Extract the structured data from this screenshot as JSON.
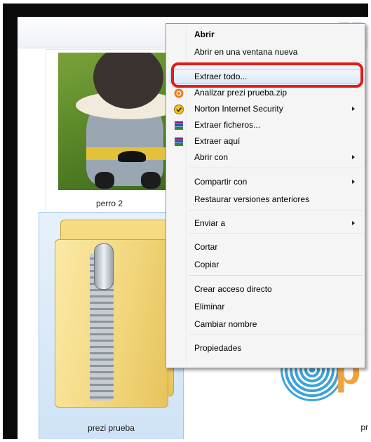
{
  "files": {
    "photo_label": "perro 2",
    "zip_label": "prezi prueba",
    "right_label": "pr"
  },
  "context_menu": {
    "items": {
      "open": "Abrir",
      "open_new_window": "Abrir en una ventana nueva",
      "extract_all": "Extraer todo...",
      "analyze": "Analizar prezi prueba.zip",
      "norton": "Norton Internet Security",
      "extract_files": "Extraer ficheros...",
      "extract_here": "Extraer aquí",
      "open_with": "Abrir con",
      "share_with": "Compartir con",
      "restore_versions": "Restaurar versiones anteriores",
      "send_to": "Enviar a",
      "cut": "Cortar",
      "copy": "Copiar",
      "create_shortcut": "Crear acceso directo",
      "delete": "Eliminar",
      "rename": "Cambiar nombre",
      "properties": "Propiedades"
    },
    "icons": {
      "analyze": "avast-icon",
      "norton": "norton-icon",
      "extract_files": "winrar-icon",
      "extract_here": "winrar-icon"
    }
  },
  "colors": {
    "highlight_outline": "#e31b1b",
    "selection_blue": "#cfe3f6"
  }
}
